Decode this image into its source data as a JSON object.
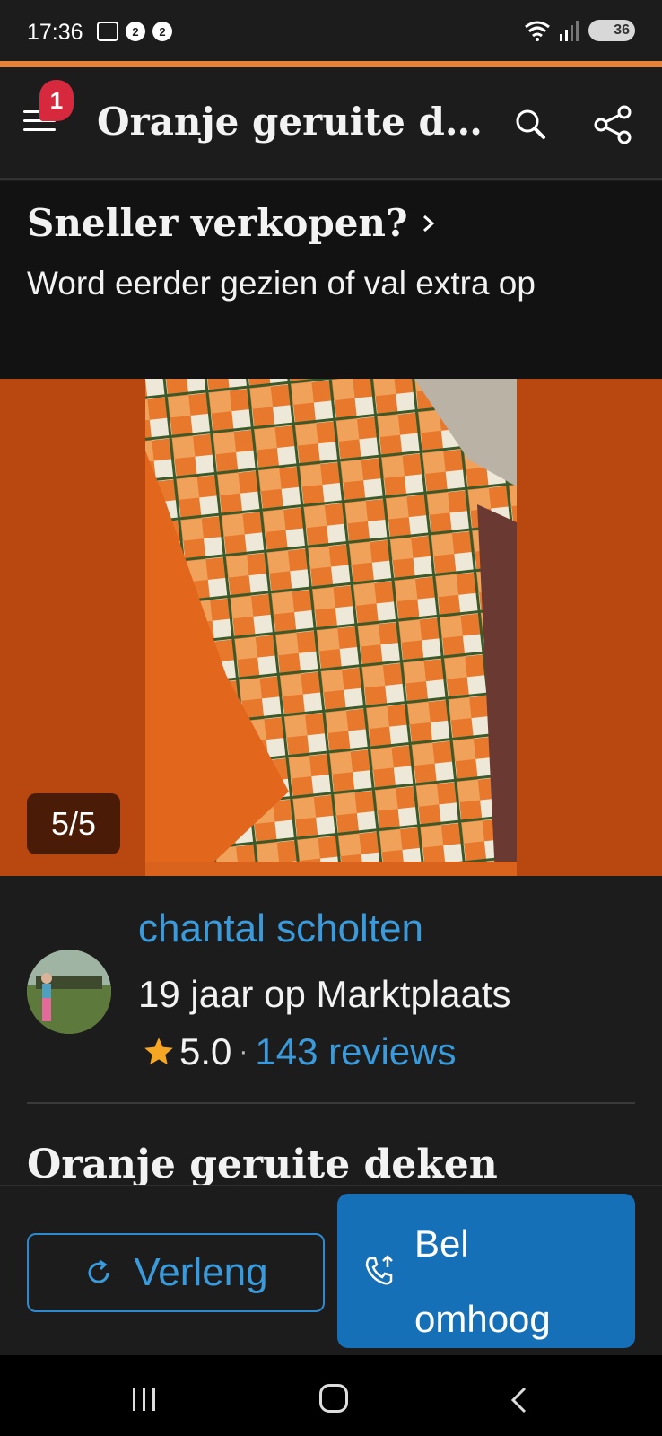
{
  "status_bar": {
    "time": "17:36",
    "battery": "36",
    "left_icons": [
      "screenshot-icon",
      "notification-2-icon",
      "notification-2-icon"
    ],
    "right_icons": [
      "wifi-icon",
      "signal-icon",
      "battery-icon"
    ]
  },
  "header": {
    "menu_badge": "1",
    "title": "Oranje geruite de..."
  },
  "promo": {
    "title": "Sneller verkopen?",
    "subtitle": "Word eerder gezien of val extra op"
  },
  "gallery": {
    "counter": "5/5"
  },
  "seller": {
    "name": "chantal scholten",
    "years": "19 jaar op Marktplaats",
    "rating": "5.0",
    "separator": "·",
    "reviews": "143 reviews"
  },
  "listing": {
    "title": "Oranje geruite deken"
  },
  "actions": {
    "renew_label": "Verleng",
    "bump_label": "Bel omhoog"
  },
  "colors": {
    "accent_blue": "#3a9bdc",
    "button_blue": "#1670b8",
    "badge_red": "#d6293d",
    "gallery_bg": "#b8480f",
    "star": "#f5a623"
  }
}
